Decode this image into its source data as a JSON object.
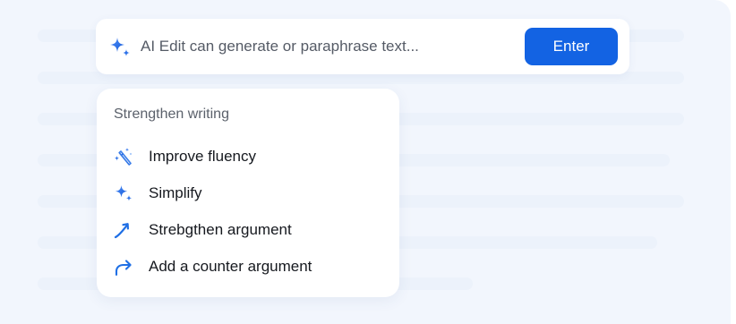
{
  "ai_bar": {
    "placeholder": "AI Edit can generate or paraphrase text...",
    "enter_label": "Enter",
    "accent_color": "#1363e3",
    "icon": "sparkle-icon"
  },
  "menu": {
    "heading": "Strengthen writing",
    "items": [
      {
        "label": "Improve fluency",
        "icon": "magic-wand-icon"
      },
      {
        "label": "Simplify",
        "icon": "sparkle-icon"
      },
      {
        "label": "Strebgthen argument",
        "icon": "trend-up-arrow-icon"
      },
      {
        "label": "Add a counter argument",
        "icon": "redirect-arrow-icon"
      }
    ]
  },
  "colors": {
    "background": "#f2f6fd",
    "icon_blue": "#1f6fe5"
  }
}
